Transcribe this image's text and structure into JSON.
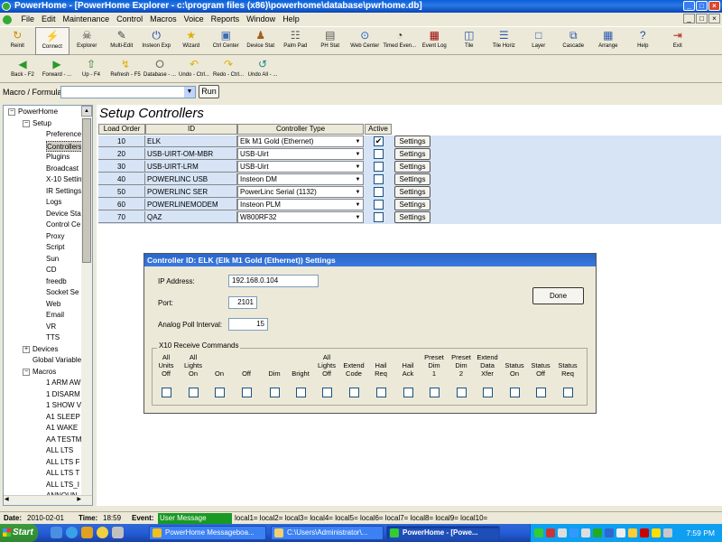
{
  "window": {
    "title": "PowerHome - [PowerHome Explorer - c:\\program files (x86)\\powerhome\\database\\pwrhome.db]",
    "min": "_",
    "max": "□",
    "close": "×"
  },
  "menu": [
    "File",
    "Edit",
    "Maintenance",
    "Control",
    "Macros",
    "Voice",
    "Reports",
    "Window",
    "Help"
  ],
  "toolbar1": [
    {
      "label": "Reinit",
      "icon": "reinit-icon",
      "glyph": "↻",
      "color": "#d48a00"
    },
    {
      "label": "Connect",
      "icon": "connect-icon",
      "glyph": "⚡",
      "color": "#c00"
    },
    {
      "label": "Explorer",
      "icon": "explorer-icon",
      "glyph": "☠",
      "color": "#333"
    },
    {
      "label": "Multi-Edit",
      "icon": "multi-edit-icon",
      "glyph": "✎",
      "color": "#444"
    },
    {
      "label": "Insteon Exp",
      "icon": "insteon-icon",
      "glyph": "⏻",
      "color": "#1a3ea8"
    },
    {
      "label": "Wizard",
      "icon": "wizard-icon",
      "glyph": "★",
      "color": "#e0b000"
    },
    {
      "label": "Ctrl Center",
      "icon": "ctrl-center-icon",
      "glyph": "▣",
      "color": "#3c6eb4"
    },
    {
      "label": "Device Stat",
      "icon": "device-stat-icon",
      "glyph": "♟",
      "color": "#a06020"
    },
    {
      "label": "Palm Pad",
      "icon": "palm-pad-icon",
      "glyph": "☷",
      "color": "#555"
    },
    {
      "label": "PH Stat",
      "icon": "ph-stat-icon",
      "glyph": "▤",
      "color": "#555"
    },
    {
      "label": "Web Center",
      "icon": "web-center-icon",
      "glyph": "⊙",
      "color": "#1a5fc8"
    },
    {
      "label": "Timed Even...",
      "icon": "timed-event-icon",
      "glyph": "◔",
      "color": "#333"
    },
    {
      "label": "Event Log",
      "icon": "event-log-icon",
      "glyph": "▦",
      "color": "#900"
    },
    {
      "label": "Tile",
      "icon": "tile-icon",
      "glyph": "◫",
      "color": "#2a5ab0"
    },
    {
      "label": "Tile Horiz",
      "icon": "tile-horiz-icon",
      "glyph": "☰",
      "color": "#2a5ab0"
    },
    {
      "label": "Layer",
      "icon": "layer-icon",
      "glyph": "□",
      "color": "#2a5ab0"
    },
    {
      "label": "Cascade",
      "icon": "cascade-icon",
      "glyph": "⧉",
      "color": "#2a5ab0"
    },
    {
      "label": "Arrange",
      "icon": "arrange-icon",
      "glyph": "▦",
      "color": "#2a5ab0"
    },
    {
      "label": "Help",
      "icon": "help-icon",
      "glyph": "?",
      "color": "#1a4fb0"
    },
    {
      "label": "Exit",
      "icon": "exit-icon",
      "glyph": "⇥",
      "color": "#b02020"
    }
  ],
  "toolbar2": [
    {
      "label": "Back - F2",
      "icon": "back-icon",
      "glyph": "◀",
      "color": "#2a9a2a"
    },
    {
      "label": "Forward - ...",
      "icon": "forward-icon",
      "glyph": "▶",
      "color": "#2a9a2a"
    },
    {
      "label": "Up - F4",
      "icon": "up-icon",
      "glyph": "⇧",
      "color": "#2a7a2a"
    },
    {
      "label": "Refresh - F5",
      "icon": "refresh-icon",
      "glyph": "↯",
      "color": "#e0b000"
    },
    {
      "label": "Database - ...",
      "icon": "database-icon",
      "glyph": "⭘",
      "color": "#666"
    },
    {
      "label": "Undo - Ctrl...",
      "icon": "undo-icon",
      "glyph": "↶",
      "color": "#e0b000"
    },
    {
      "label": "Redo - Ctrl...",
      "icon": "redo-icon",
      "glyph": "↷",
      "color": "#e0b000"
    },
    {
      "label": "Undo All - ...",
      "icon": "undo-all-icon",
      "glyph": "↺",
      "color": "#1a8a8a"
    }
  ],
  "macrobar": {
    "label": "Macro / Formula:",
    "value": "",
    "run": "Run",
    "dropdown": "▼"
  },
  "tree": [
    {
      "label": "PowerHome",
      "exp": "−"
    },
    {
      "label": "Setup",
      "exp": "−"
    },
    {
      "label": "Preference"
    },
    {
      "label": "Controllers"
    },
    {
      "label": "Plugins"
    },
    {
      "label": "Broadcast"
    },
    {
      "label": "X-10 Settin"
    },
    {
      "label": "IR Settings"
    },
    {
      "label": "Logs"
    },
    {
      "label": "Device Sta"
    },
    {
      "label": "Control Ce"
    },
    {
      "label": "Proxy"
    },
    {
      "label": "Script"
    },
    {
      "label": "Sun"
    },
    {
      "label": "CD"
    },
    {
      "label": "freedb"
    },
    {
      "label": "Socket Se"
    },
    {
      "label": "Web"
    },
    {
      "label": "Email"
    },
    {
      "label": "VR"
    },
    {
      "label": "TTS"
    },
    {
      "label": "Devices",
      "exp": "+"
    },
    {
      "label": "Global Variable"
    },
    {
      "label": "Macros",
      "exp": "−"
    },
    {
      "label": "1 ARM AW"
    },
    {
      "label": "1 DISARM"
    },
    {
      "label": "1 SHOW V"
    },
    {
      "label": "A1 SLEEP"
    },
    {
      "label": "A1 WAKE"
    },
    {
      "label": "AA TESTM"
    },
    {
      "label": "ALL LTS"
    },
    {
      "label": "ALL LTS F"
    },
    {
      "label": "ALL LTS T"
    },
    {
      "label": "ALL LTS_I"
    },
    {
      "label": "ANNOUN"
    }
  ],
  "scroll": {
    "up": "▲",
    "down": "▼",
    "left": "◀",
    "right": "▶"
  },
  "main": {
    "title": "Setup Controllers",
    "columns": [
      "Load Order",
      "ID",
      "Controller Type",
      "Active"
    ],
    "rows": [
      {
        "order": "10",
        "id": "ELK",
        "type": "Elk M1 Gold (Ethernet)",
        "active": true,
        "btn": "Settings"
      },
      {
        "order": "20",
        "id": "USB-UIRT-OM-MBR",
        "type": "USB-Uirt",
        "active": false,
        "btn": "Settings"
      },
      {
        "order": "30",
        "id": "USB-UIRT-LRM",
        "type": "USB-Uirt",
        "active": false,
        "btn": "Settings"
      },
      {
        "order": "40",
        "id": "POWERLINC USB",
        "type": "Insteon DM",
        "active": false,
        "btn": "Settings"
      },
      {
        "order": "50",
        "id": "POWERLINC SER",
        "type": "PowerLinc Serial (1132)",
        "active": false,
        "btn": "Settings"
      },
      {
        "order": "60",
        "id": "POWERLINEMODEM",
        "type": "Insteon PLM",
        "active": false,
        "btn": "Settings"
      },
      {
        "order": "70",
        "id": "QAZ",
        "type": "W800RF32",
        "active": false,
        "btn": "Settings"
      }
    ]
  },
  "dialog": {
    "title": "Controller ID: ELK (Elk M1 Gold (Ethernet)) Settings",
    "ip_label": "IP Address:",
    "ip_value": "192.168.0.104",
    "port_label": "Port:",
    "port_value": "2101",
    "poll_label": "Analog Poll Interval:",
    "poll_value": "15",
    "done": "Done",
    "x10_label": "X10 Receive Commands",
    "x10_cols": [
      [
        "All",
        "Units",
        "Off"
      ],
      [
        "All",
        "Lights",
        "On"
      ],
      [
        "",
        "",
        "On"
      ],
      [
        "",
        "",
        "Off"
      ],
      [
        "",
        "",
        "Dim"
      ],
      [
        "",
        "",
        "Bright"
      ],
      [
        "All",
        "Lights",
        "Off"
      ],
      [
        "",
        "Extend",
        "Code"
      ],
      [
        "",
        "Hail",
        "Req"
      ],
      [
        "",
        "Hail",
        "Ack"
      ],
      [
        "Preset",
        "Dim",
        "1"
      ],
      [
        "Preset",
        "Dim",
        "2"
      ],
      [
        "Extend",
        "Data",
        "Xfer"
      ],
      [
        "",
        "Status",
        "On"
      ],
      [
        "",
        "Status",
        "Off"
      ],
      [
        "",
        "Status",
        "Req"
      ]
    ]
  },
  "statusbar": {
    "date_label": "Date:",
    "date": "2010-02-01",
    "time_label": "Time:",
    "time": "18:59",
    "event_label": "Event:",
    "event": "User Message",
    "locals": "local1= local2= local3= local4= local5= local6= local7= local8= local9= local10="
  },
  "taskbar": {
    "start": "Start",
    "tasks": [
      {
        "label": "PowerHome Messageboa...",
        "color": "#f0c020",
        "active": false
      },
      {
        "label": "C:\\Users\\Administrator\\...",
        "color": "#f0d070",
        "active": false
      },
      {
        "label": "PowerHome - [Powe...",
        "color": "#3c3",
        "active": true
      }
    ],
    "clock": "7:59 PM"
  }
}
